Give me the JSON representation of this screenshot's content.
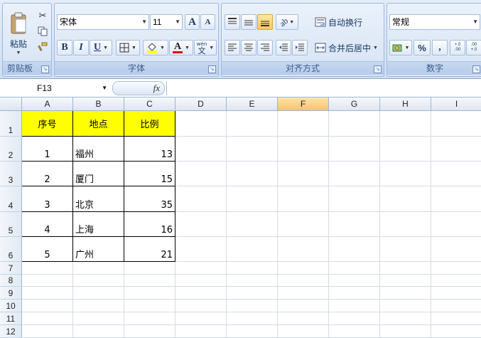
{
  "ribbon": {
    "clipboard": {
      "label": "剪贴板",
      "paste_label": "粘贴"
    },
    "font": {
      "label": "字体",
      "font_name": "宋体",
      "font_size": "11",
      "bold": "B",
      "italic": "I",
      "underline": "U",
      "grow": "A",
      "shrink": "A",
      "font_color_glyph": "A",
      "phonetic_glyph": "文",
      "phonetic_top": "wén"
    },
    "alignment": {
      "label": "对齐方式",
      "wrap_text": "自动换行",
      "merge_center": "合并后居中"
    },
    "number": {
      "label": "数字",
      "format": "常规",
      "percent": "%",
      "comma": ",",
      "inc_decimal": "+.0 .00",
      "dec_decimal": ".00 +.0"
    }
  },
  "formula_bar": {
    "name_box": "F13",
    "fx": "fx",
    "formula": ""
  },
  "columns": [
    "A",
    "B",
    "C",
    "D",
    "E",
    "F",
    "G",
    "H",
    "I"
  ],
  "rows": [
    "1",
    "2",
    "3",
    "4",
    "5",
    "6",
    "7",
    "8",
    "9",
    "10",
    "11",
    "12"
  ],
  "table": {
    "headers": [
      "序号",
      "地点",
      "比例"
    ],
    "rows": [
      [
        "1",
        "福州",
        "13"
      ],
      [
        "2",
        "厦门",
        "15"
      ],
      [
        "3",
        "北京",
        "35"
      ],
      [
        "4",
        "上海",
        "16"
      ],
      [
        "5",
        "广州",
        "21"
      ]
    ]
  },
  "colors": {
    "header_fill": "#ffff00",
    "selected_col_header": "#f5c56a",
    "ribbon_bg": "#dbe6f4"
  }
}
